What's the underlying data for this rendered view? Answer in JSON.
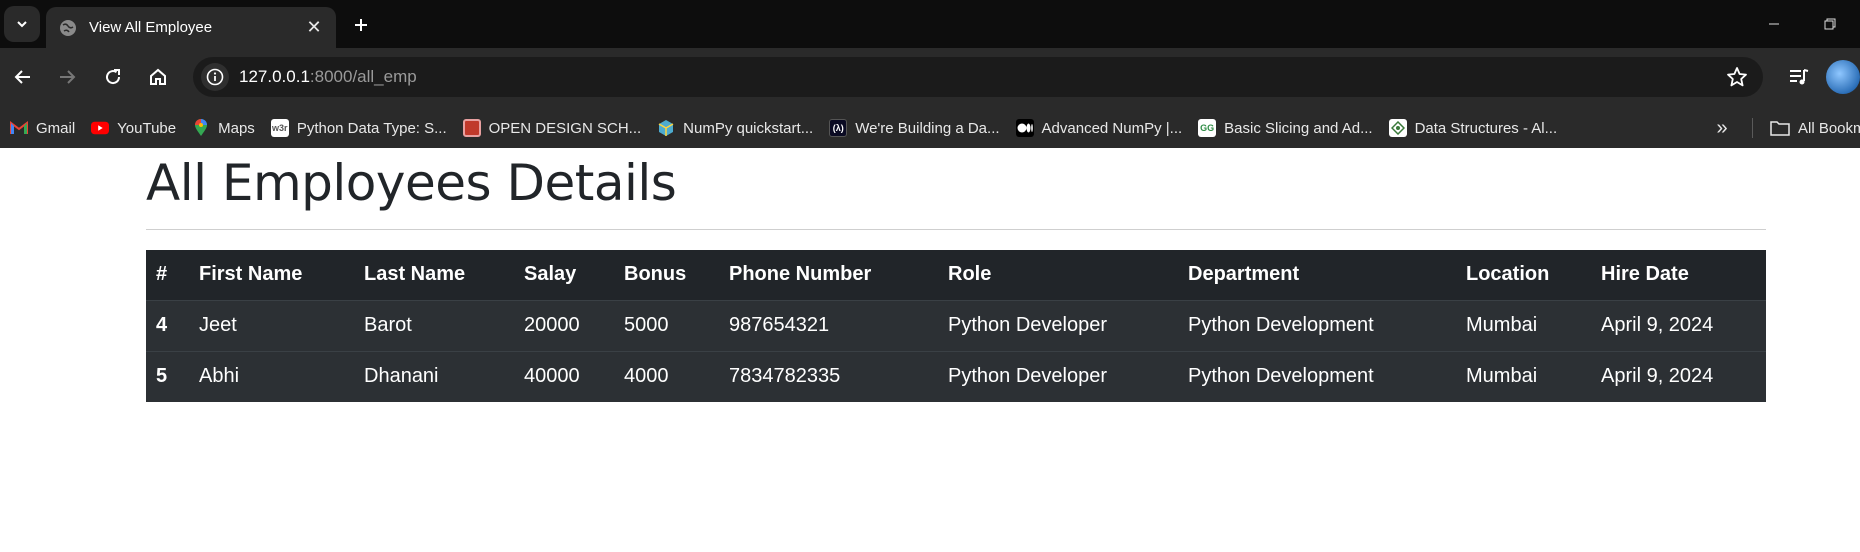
{
  "browser": {
    "tab_title": "View All Employee",
    "url_host": "127.0.0.1",
    "url_rest": ":8000/all_emp",
    "bookmarks": [
      {
        "label": "Gmail",
        "icon": "gmail-icon",
        "color": "#ea4335"
      },
      {
        "label": "YouTube",
        "icon": "youtube-icon",
        "color": "#ff0000"
      },
      {
        "label": "Maps",
        "icon": "maps-icon",
        "color": "#34a853"
      },
      {
        "label": "Python Data Type: S...",
        "icon": "w3r-icon",
        "color": "#ffffff"
      },
      {
        "label": "OPEN DESIGN SCH...",
        "icon": "design-icon",
        "color": "#c0392b"
      },
      {
        "label": "NumPy quickstart...",
        "icon": "numpy-icon",
        "color": "#4dabcf"
      },
      {
        "label": "We're Building a Da...",
        "icon": "freecodecamp-icon",
        "color": "#0a0a23"
      },
      {
        "label": "Advanced NumPy |...",
        "icon": "medium-icon",
        "color": "#000000"
      },
      {
        "label": "Basic Slicing and Ad...",
        "icon": "gfg-icon",
        "color": "#2f8d46"
      },
      {
        "label": "Data Structures - Al...",
        "icon": "datastructures-icon",
        "color": "#3a7a3a"
      }
    ],
    "all_bookmarks": "All Bookmarks"
  },
  "page": {
    "title": "All Employees Details"
  },
  "table": {
    "headers": [
      "#",
      "First Name",
      "Last Name",
      "Salay",
      "Bonus",
      "Phone Number",
      "Role",
      "Department",
      "Location",
      "Hire Date"
    ],
    "rows": [
      [
        "4",
        "Jeet",
        "Barot",
        "20000",
        "5000",
        "987654321",
        "Python Developer",
        "Python Development",
        "Mumbai",
        "April 9, 2024"
      ],
      [
        "5",
        "Abhi",
        "Dhanani",
        "40000",
        "4000",
        "7834782335",
        "Python Developer",
        "Python Development",
        "Mumbai",
        "April 9, 2024"
      ]
    ]
  }
}
